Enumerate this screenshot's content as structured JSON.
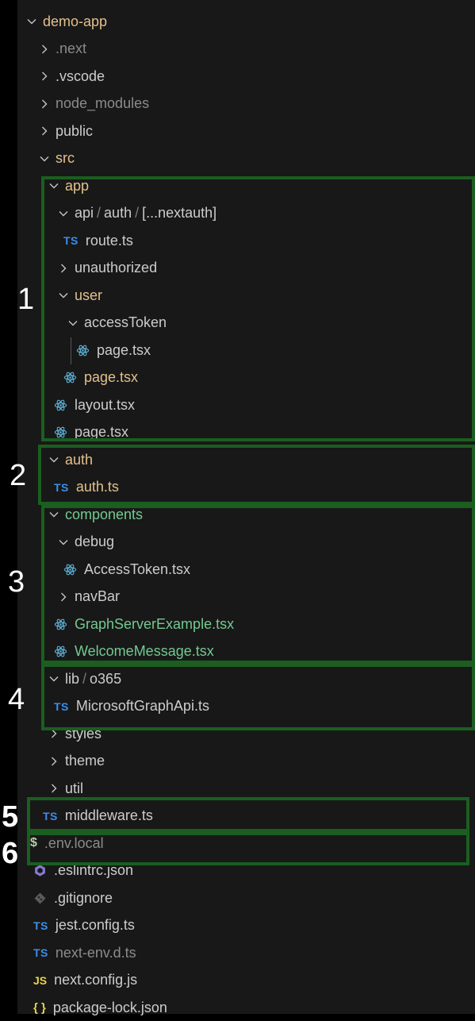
{
  "explorer": {
    "items": [
      {
        "name": "folder-demo-app",
        "label": "demo-app",
        "type": "folder-open",
        "color": "mod",
        "icon": "chevron-down-icon"
      },
      {
        "name": "folder-next",
        "label": ".next",
        "type": "folder-closed",
        "color": "dim",
        "icon": "chevron-right-icon"
      },
      {
        "name": "folder-vscode",
        "label": ".vscode",
        "type": "folder-closed",
        "color": "default",
        "icon": "chevron-right-icon"
      },
      {
        "name": "folder-node-modules",
        "label": "node_modules",
        "type": "folder-closed",
        "color": "dim",
        "icon": "chevron-right-icon"
      },
      {
        "name": "folder-public",
        "label": "public",
        "type": "folder-closed",
        "color": "default",
        "icon": "chevron-right-icon"
      },
      {
        "name": "folder-src",
        "label": "src",
        "type": "folder-open",
        "color": "mod",
        "icon": "chevron-down-icon"
      },
      {
        "name": "folder-app",
        "label": "app",
        "type": "folder-open",
        "color": "mod",
        "icon": "chevron-down-icon"
      },
      {
        "name": "folder-api-auth-nextauth",
        "segments": [
          "api",
          "auth",
          "[...nextauth]"
        ],
        "type": "folder-open",
        "color": "default",
        "icon": "chevron-down-icon"
      },
      {
        "name": "file-route-ts",
        "label": "route.ts",
        "type": "file",
        "color": "default",
        "icon": "typescript-file-icon",
        "badge": "TS"
      },
      {
        "name": "folder-unauthorized",
        "label": "unauthorized",
        "type": "folder-closed",
        "color": "default",
        "icon": "chevron-right-icon"
      },
      {
        "name": "folder-user",
        "label": "user",
        "type": "folder-open",
        "color": "mod",
        "icon": "chevron-down-icon"
      },
      {
        "name": "folder-access-token",
        "label": "accessToken",
        "type": "folder-open",
        "color": "default",
        "icon": "chevron-down-icon"
      },
      {
        "name": "file-access-token-page-tsx",
        "label": "page.tsx",
        "type": "file",
        "color": "default",
        "icon": "react-file-icon"
      },
      {
        "name": "file-user-page-tsx",
        "label": "page.tsx",
        "type": "file",
        "color": "mod",
        "icon": "react-file-icon"
      },
      {
        "name": "file-layout-tsx",
        "label": "layout.tsx",
        "type": "file",
        "color": "default",
        "icon": "react-file-icon"
      },
      {
        "name": "file-app-page-tsx",
        "label": "page.tsx",
        "type": "file",
        "color": "default",
        "icon": "react-file-icon"
      },
      {
        "name": "folder-auth",
        "label": "auth",
        "type": "folder-open",
        "color": "mod",
        "icon": "chevron-down-icon"
      },
      {
        "name": "file-auth-ts",
        "label": "auth.ts",
        "type": "file",
        "color": "mod",
        "icon": "typescript-file-icon",
        "badge": "TS"
      },
      {
        "name": "folder-components",
        "label": "components",
        "type": "folder-open",
        "color": "new",
        "icon": "chevron-down-icon"
      },
      {
        "name": "folder-debug",
        "label": "debug",
        "type": "folder-open",
        "color": "default",
        "icon": "chevron-down-icon"
      },
      {
        "name": "file-access-token-tsx",
        "label": "AccessToken.tsx",
        "type": "file",
        "color": "default",
        "icon": "react-file-icon"
      },
      {
        "name": "folder-navbar",
        "label": "navBar",
        "type": "folder-closed",
        "color": "default",
        "icon": "chevron-right-icon"
      },
      {
        "name": "file-graph-server-example-tsx",
        "label": "GraphServerExample.tsx",
        "type": "file",
        "color": "new",
        "icon": "react-file-icon"
      },
      {
        "name": "file-welcome-message-tsx",
        "label": "WelcomeMessage.tsx",
        "type": "file",
        "color": "new",
        "icon": "react-file-icon"
      },
      {
        "name": "folder-lib-o365",
        "segments": [
          "lib",
          "o365"
        ],
        "type": "folder-open",
        "color": "default",
        "icon": "chevron-down-icon"
      },
      {
        "name": "file-microsoft-graph-api-ts",
        "label": "MicrosoftGraphApi.ts",
        "type": "file",
        "color": "default",
        "icon": "typescript-file-icon",
        "badge": "TS"
      },
      {
        "name": "folder-styles",
        "label": "styles",
        "type": "folder-closed",
        "color": "default",
        "icon": "chevron-right-icon"
      },
      {
        "name": "folder-theme",
        "label": "theme",
        "type": "folder-closed",
        "color": "default",
        "icon": "chevron-right-icon"
      },
      {
        "name": "folder-util",
        "label": "util",
        "type": "folder-closed",
        "color": "default",
        "icon": "chevron-right-icon"
      },
      {
        "name": "file-middleware-ts",
        "label": "middleware.ts",
        "type": "file",
        "color": "default",
        "icon": "typescript-file-icon",
        "badge": "TS"
      },
      {
        "name": "file-env-local",
        "label": ".env.local",
        "type": "file",
        "color": "dim",
        "icon": "dollar-sign-icon",
        "badge": "$"
      },
      {
        "name": "file-eslintrc-json",
        "label": ".eslintrc.json",
        "type": "file",
        "color": "default",
        "icon": "eslint-file-icon"
      },
      {
        "name": "file-gitignore",
        "label": ".gitignore",
        "type": "file",
        "color": "default",
        "icon": "git-file-icon"
      },
      {
        "name": "file-jest-config-ts",
        "label": "jest.config.ts",
        "type": "file",
        "color": "default",
        "icon": "typescript-file-icon",
        "badge": "TS"
      },
      {
        "name": "file-next-env-d-ts",
        "label": "next-env.d.ts",
        "type": "file",
        "color": "dim",
        "icon": "typescript-file-icon",
        "badge": "TS"
      },
      {
        "name": "file-next-config-js",
        "label": "next.config.js",
        "type": "file",
        "color": "default",
        "icon": "javascript-file-icon",
        "badge": "JS"
      },
      {
        "name": "file-package-lock-json",
        "label": "package-lock.json",
        "type": "file",
        "color": "default",
        "icon": "json-file-icon",
        "badge": "{ }"
      }
    ]
  },
  "annotations": [
    {
      "label": "1"
    },
    {
      "label": "2"
    },
    {
      "label": "3"
    },
    {
      "label": "4"
    },
    {
      "label": "5"
    },
    {
      "label": "6"
    }
  ],
  "colors": {
    "background": "#181818",
    "text": "#cccccc",
    "dimmed": "#8b8b8b",
    "modified": "#e2c08d",
    "untracked": "#73c991",
    "typescript": "#3b8eea",
    "react": "#5fb3d9",
    "annotation_box": "#1b5e20"
  }
}
